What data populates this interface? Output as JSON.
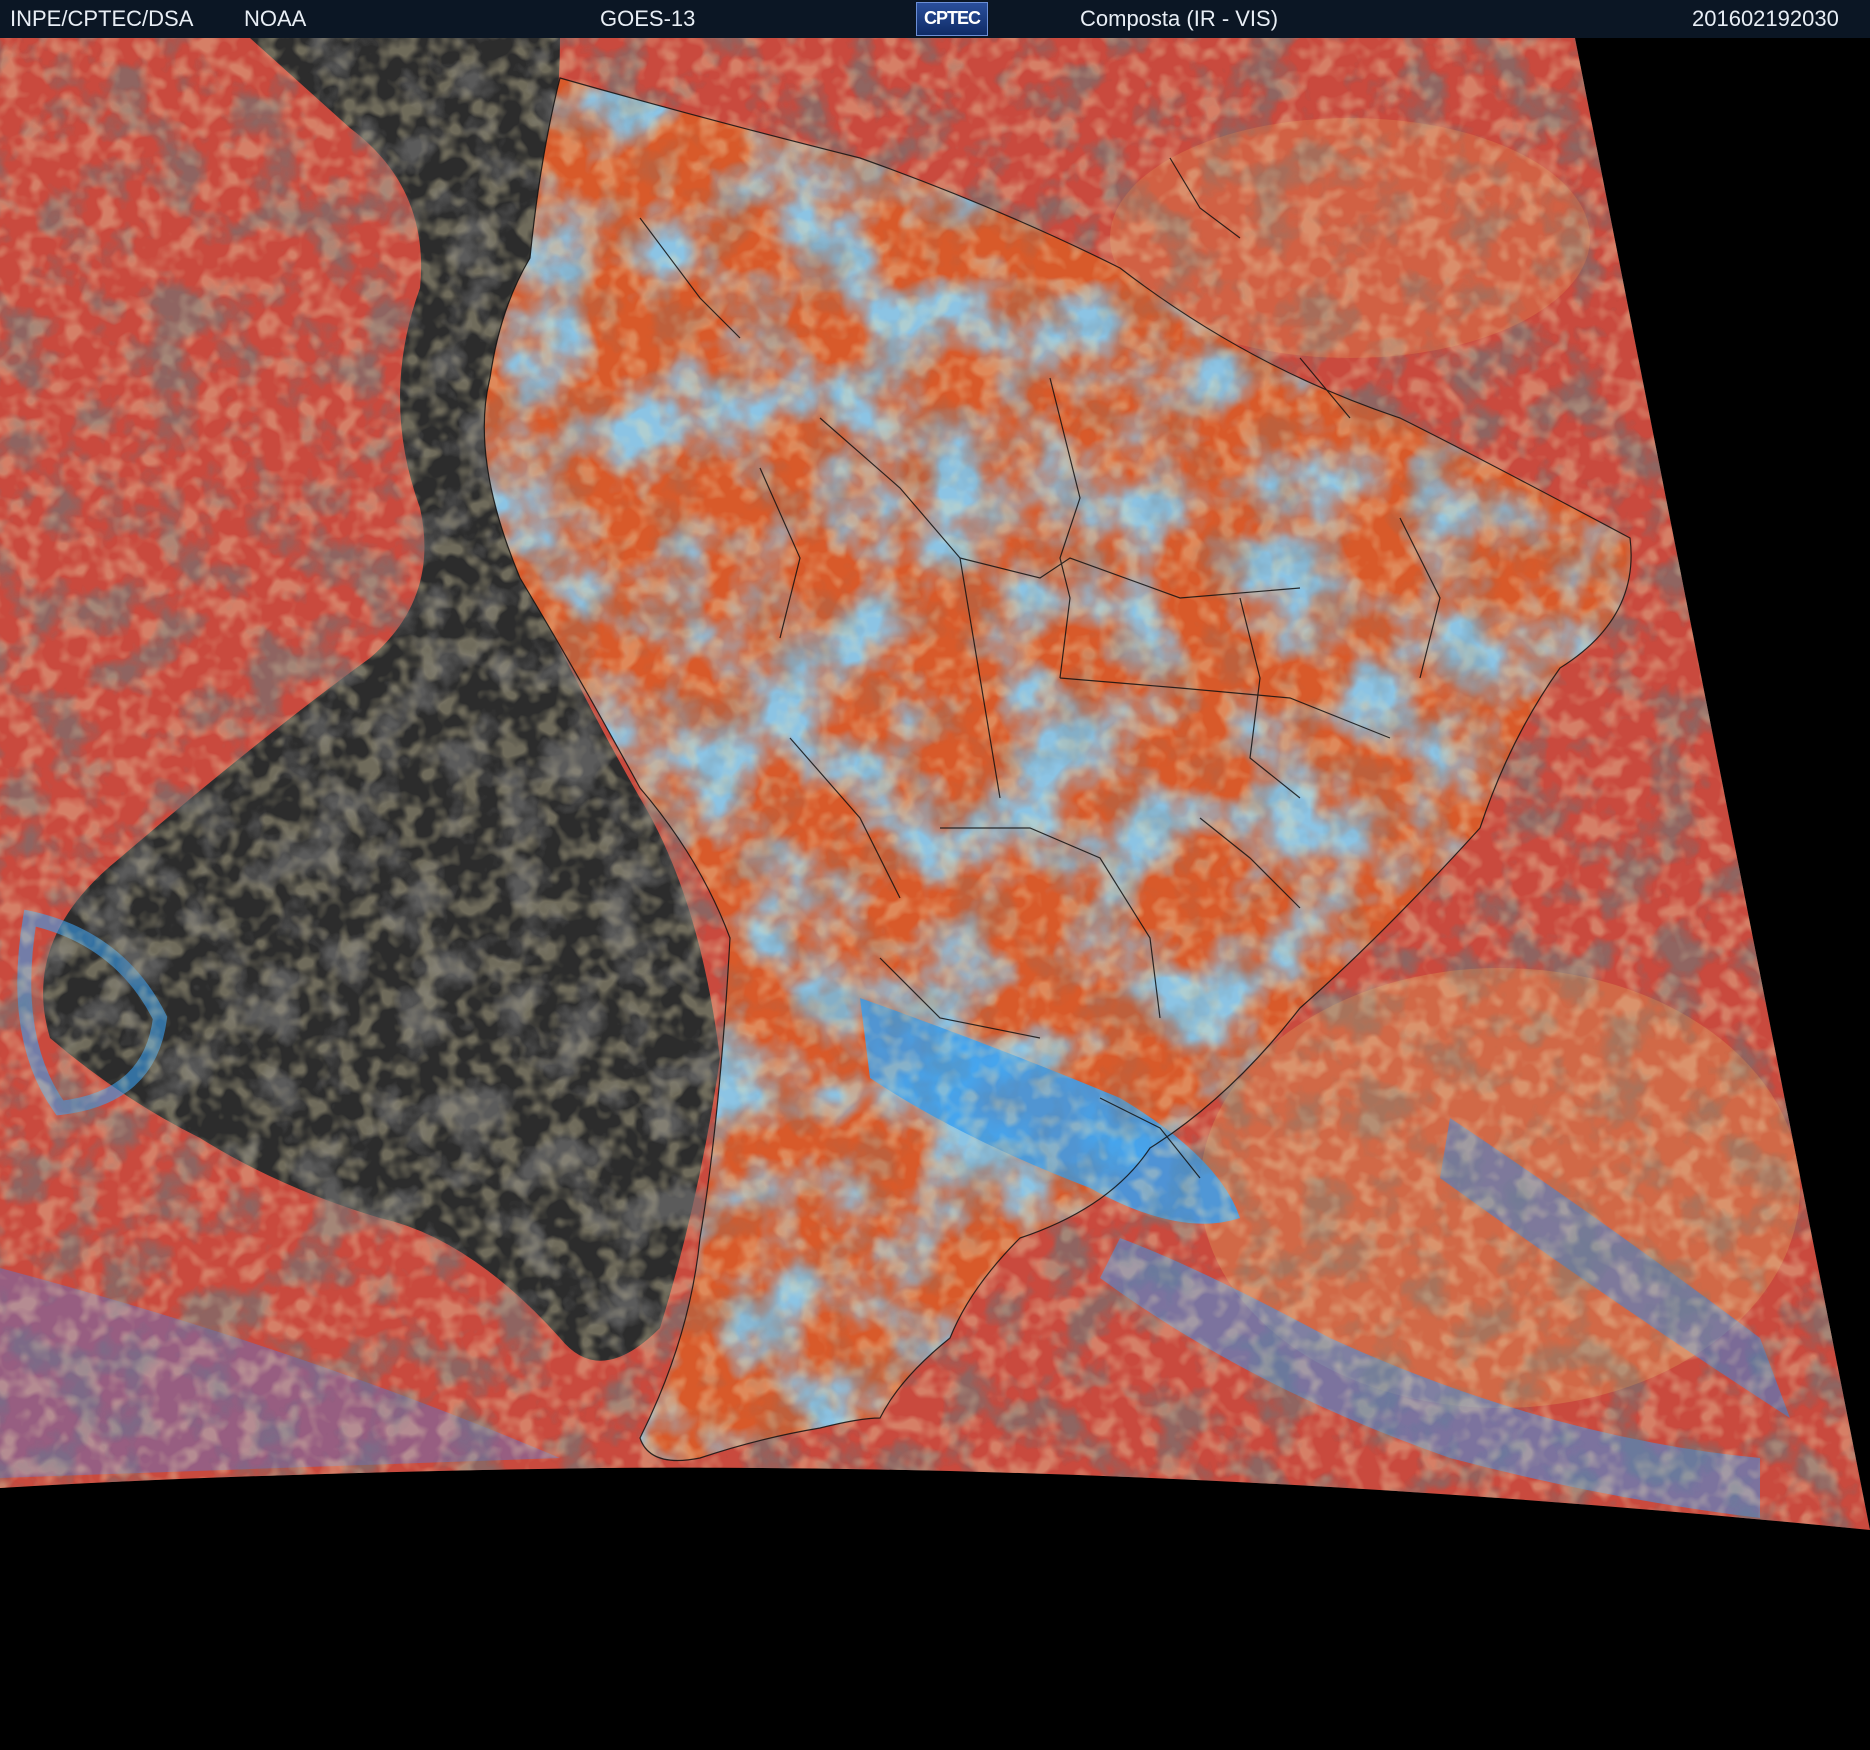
{
  "header": {
    "institution": "INPE/CPTEC/DSA",
    "agency": "NOAA",
    "satellite": "GOES-13",
    "logo_text": "CPTEC",
    "product": "Composta (IR - VIS)",
    "timestamp": "201602192030"
  },
  "colors": {
    "header_bg": "#0b1624",
    "ocean_clear": "#c94a3e",
    "land_warm": "#d85a2a",
    "deep_convection": "#3aa0f0",
    "low_cloud": "#2c2c2c",
    "borders": "#111111"
  }
}
